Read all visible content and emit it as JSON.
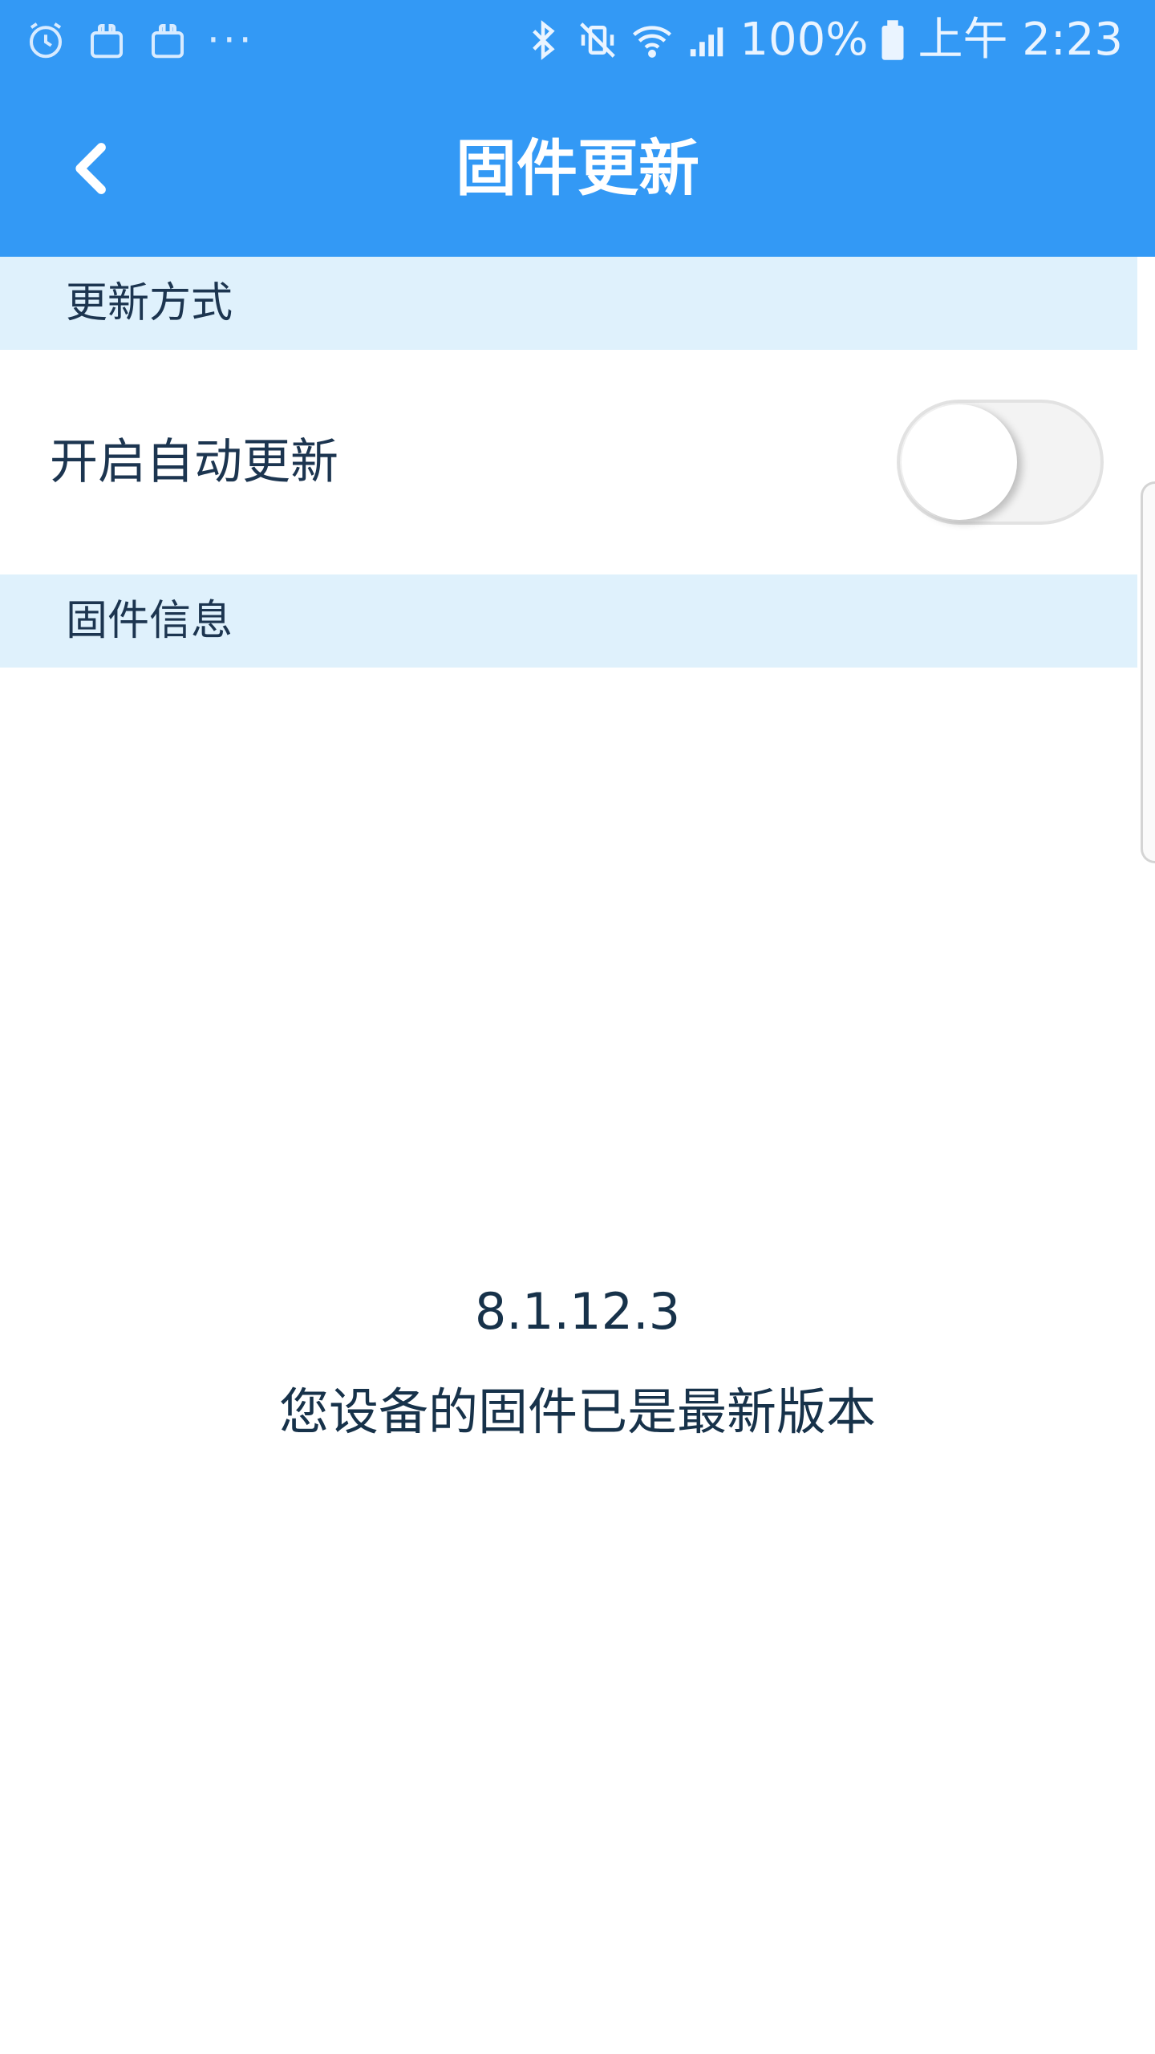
{
  "status_bar": {
    "left_icons": [
      "alarm-icon",
      "shopping-bag-icon",
      "shopping-bag-icon",
      "more-dots-icon"
    ],
    "more": "···",
    "right_icons": [
      "bluetooth-icon",
      "vibrate-mute-icon",
      "wifi-icon",
      "signal-icon",
      "battery-icon"
    ],
    "battery": "100%",
    "time": "上午 2:23"
  },
  "header": {
    "title": "固件更新",
    "back_icon": "chevron-left-icon",
    "background": "#3399f5"
  },
  "sections": {
    "update_method": {
      "title": "更新方式"
    },
    "firmware_info": {
      "title": "固件信息"
    }
  },
  "settings": {
    "auto_update": {
      "label": "开启自动更新",
      "enabled": false
    }
  },
  "firmware": {
    "version": "8.1.12.3",
    "status": "您设备的固件已是最新版本"
  },
  "colors": {
    "accent": "#3399f5",
    "section_bg": "#dff1fc",
    "text": "#17324a"
  }
}
